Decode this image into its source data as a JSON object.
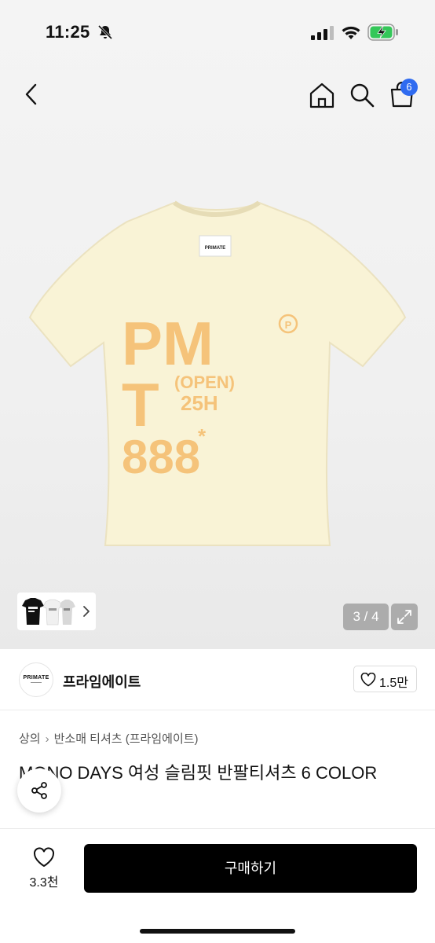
{
  "status_bar": {
    "time": "11:25",
    "icons": [
      "bell-slash-icon",
      "signal-icon",
      "wifi-icon",
      "battery-charging-icon"
    ]
  },
  "header": {
    "icons": [
      "back-icon",
      "home-icon",
      "search-icon",
      "shopping-bag-icon"
    ],
    "cart_count": "6"
  },
  "product_image": {
    "graphic_text": {
      "line1": "PM",
      "line2_big": "T",
      "line2_small_top": "(OPEN)",
      "line2_small_bottom": "25H",
      "line3": "888",
      "line3_mark": "*",
      "badge": "P",
      "neck_label": "PRIMATE"
    },
    "shirt_color": "#f9f3d6",
    "print_color": "#f5c37a"
  },
  "gallery": {
    "pager": "3 / 4",
    "thumbnail_icon": "chevron-right-icon",
    "expand_icon": "expand-icon"
  },
  "brand": {
    "logo_text": "PRIMATE",
    "name": "프라임에이트",
    "likes": "1.5만"
  },
  "breadcrumb": {
    "items": [
      "상의",
      "반소매 티셔츠 (프라임에이트)"
    ]
  },
  "product": {
    "title": "MONO DAYS 여성 슬림핏 반팔티셔츠 6 COLOR"
  },
  "bottom_bar": {
    "wish_count": "3.3천",
    "buy_label": "구매하기"
  }
}
